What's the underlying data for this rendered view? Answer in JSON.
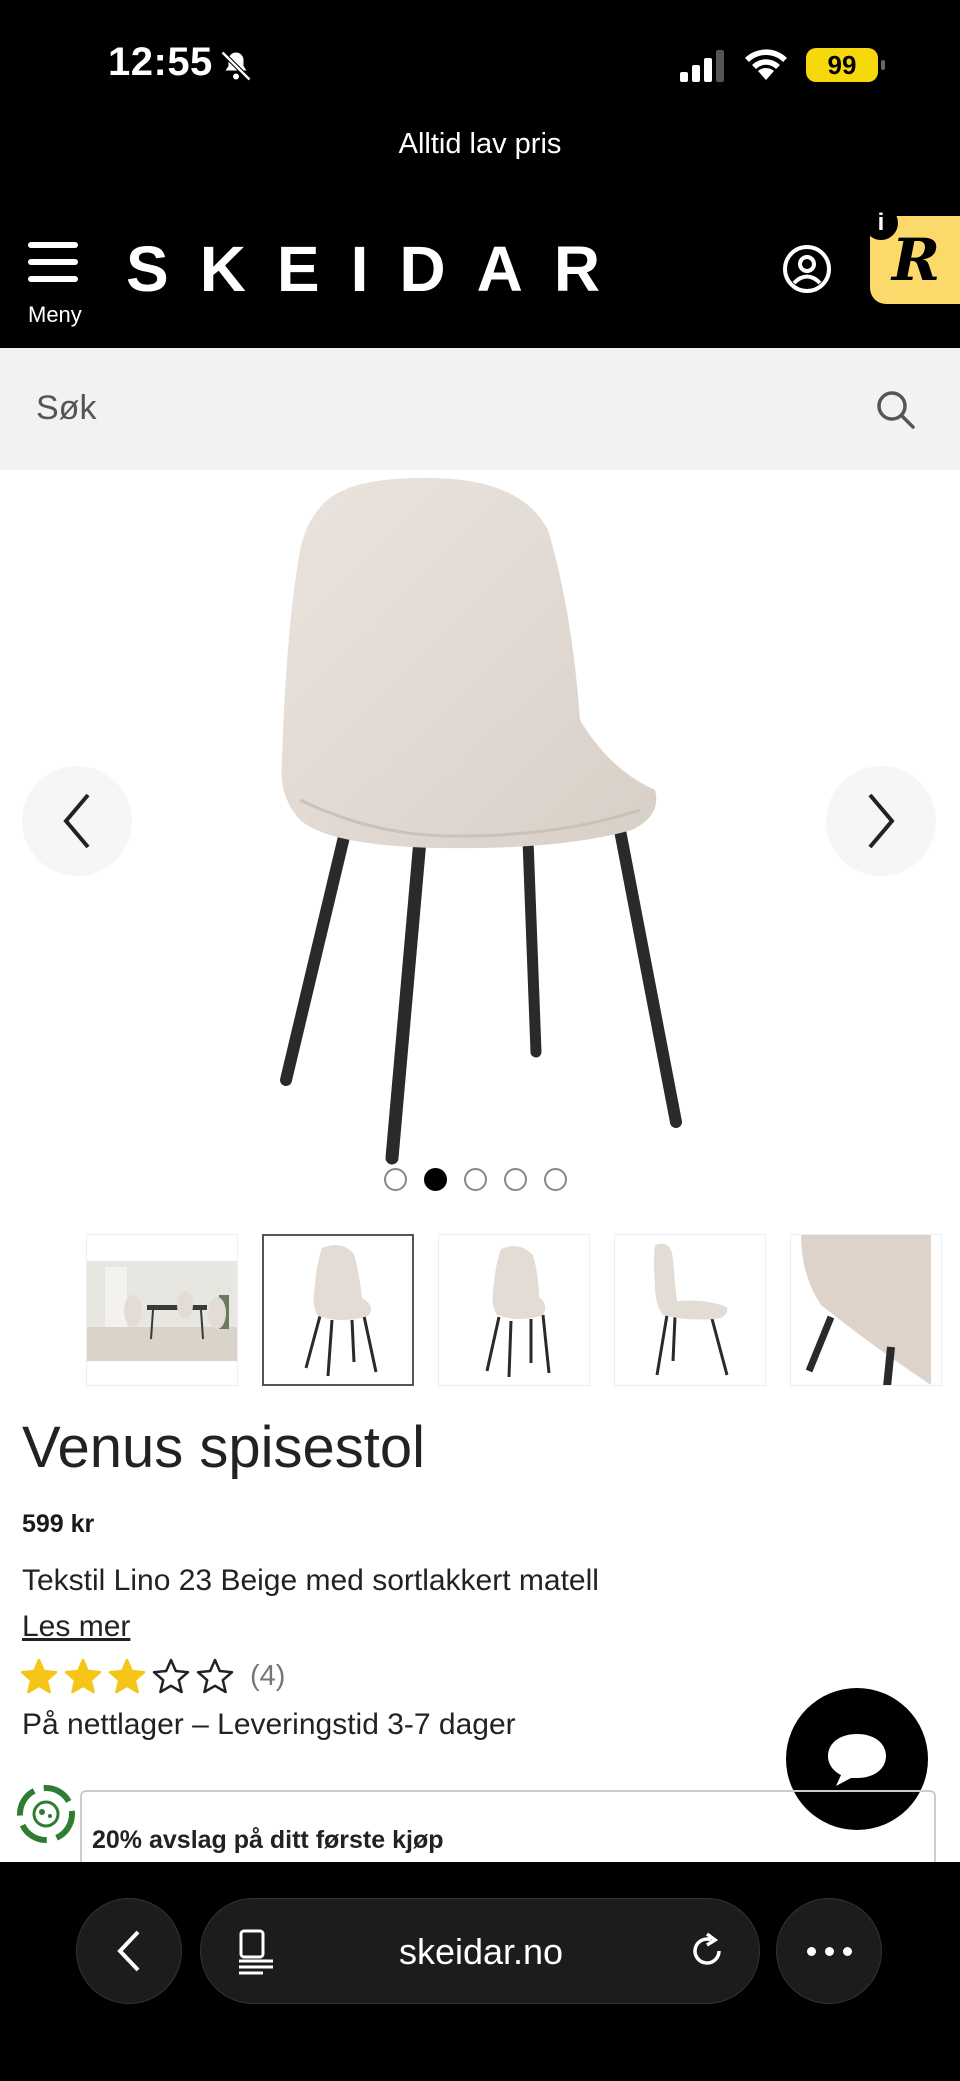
{
  "status": {
    "time": "12:55",
    "battery": "99"
  },
  "header": {
    "promo": "Alltid lav pris",
    "menu_label": "Meny",
    "logo": "SKEIDAR",
    "reward_letter": "R",
    "reward_info": "i"
  },
  "search": {
    "placeholder": "Søk"
  },
  "gallery": {
    "dot_count": 5,
    "active_dot": 1,
    "thumb_count": 5,
    "selected_thumb": 1
  },
  "product": {
    "title": "Venus spisestol",
    "price": "599 kr",
    "description": "Tekstil Lino 23 Beige med sortlakkert matell",
    "read_more": "Les mer",
    "rating": 3,
    "rating_max": 5,
    "rating_count": "(4)",
    "stock": "På nettlager – Leveringstid 3-7 dager"
  },
  "promo_box": {
    "text": "20% avslag på ditt første kjøp"
  },
  "browser": {
    "url": "skeidar.no"
  },
  "colors": {
    "star": "#f5c518",
    "reward_badge": "#fbd96a",
    "battery": "#f5d90a"
  }
}
